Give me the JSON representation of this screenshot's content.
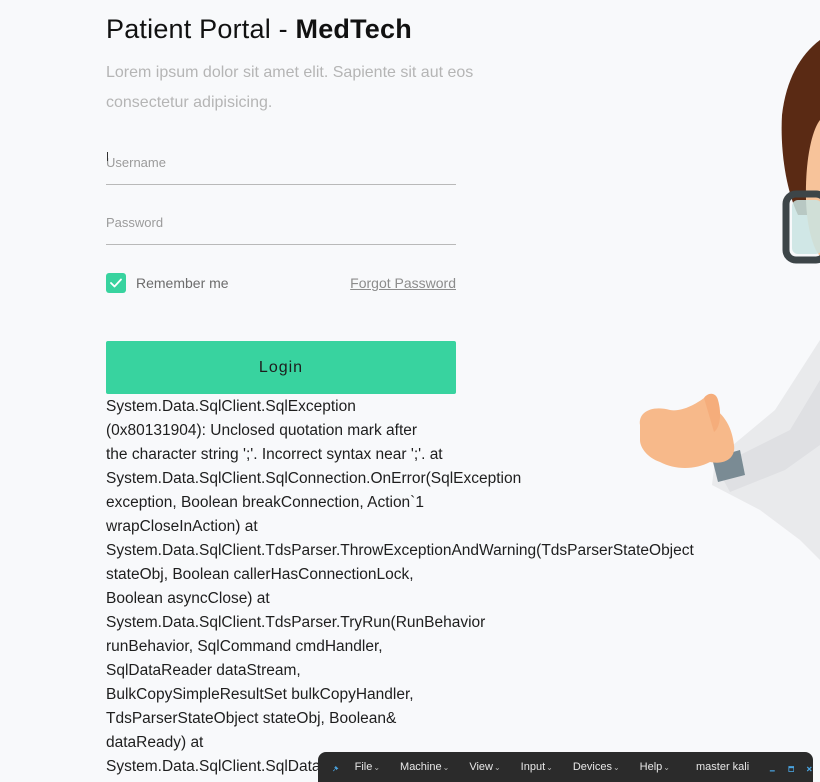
{
  "portal": {
    "title_prefix": "Patient Portal - ",
    "title_brand": "MedTech",
    "subtitle": "Lorem ipsum dolor sit amet elit. Sapiente sit aut eos consectetur adipisicing."
  },
  "form": {
    "username_placeholder": "Username",
    "password_placeholder": "Password",
    "remember_label": "Remember me",
    "remember_checked": true,
    "forgot_label": "Forgot Password",
    "login_label": "Login"
  },
  "error_lines": [
    "System.Data.SqlClient.SqlException",
    "(0x80131904): Unclosed quotation mark after",
    "the character string ';'. Incorrect syntax near ';'. at",
    "System.Data.SqlClient.SqlConnection.OnError(SqlException",
    "exception, Boolean breakConnection, Action`1",
    "wrapCloseInAction) at",
    "System.Data.SqlClient.TdsParser.ThrowExceptionAndWarning(TdsParserStateObject",
    "stateObj, Boolean callerHasConnectionLock,",
    "Boolean asyncClose) at",
    "System.Data.SqlClient.TdsParser.TryRun(RunBehavior",
    "runBehavior, SqlCommand cmdHandler,",
    "SqlDataReader dataStream,",
    "BulkCopySimpleResultSet bulkCopyHandler,",
    "TdsParserStateObject stateObj, Boolean&",
    "dataReady) at",
    "System.Data.SqlClient.SqlDataReader.TryConsumeMetaData() at"
  ],
  "vm_bar": {
    "menu": [
      "File",
      "Machine",
      "View",
      "Input",
      "Devices",
      "Help"
    ],
    "vm_name": "master kali"
  },
  "colors": {
    "accent": "#38d39f",
    "background": "#f8f9fb"
  },
  "icons": {
    "pin": "pin-icon",
    "check": "checkmark-icon",
    "minimize": "minimize-icon",
    "restore": "restore-icon",
    "close": "close-icon"
  }
}
